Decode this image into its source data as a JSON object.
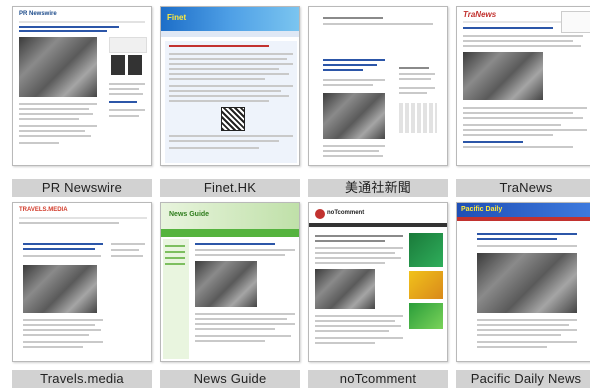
{
  "tiles": [
    {
      "label": "PR  Newswire",
      "logo": "PR Newswire"
    },
    {
      "label": "Finet.HK",
      "logo": "Finet"
    },
    {
      "label": "美通社新聞",
      "logo": ""
    },
    {
      "label": "TraNews",
      "logo": "TraNews"
    },
    {
      "label": "Travels.media",
      "logo": "TRAVELS.MEDIA"
    },
    {
      "label": "News  Guide",
      "logo": "News Guide"
    },
    {
      "label": "noTcomment",
      "logo": "noTcomment"
    },
    {
      "label": "Pacific  Daily  News",
      "logo": "Pacific Daily"
    }
  ],
  "colors": {
    "caption_bg": "#d2d2d2",
    "caption_text": "#222222",
    "finet_banner": "#2a7fd0",
    "newsguide_green": "#55b33e",
    "notcomment_red": "#c2322f",
    "pacific_blue": "#1f4fb5"
  }
}
